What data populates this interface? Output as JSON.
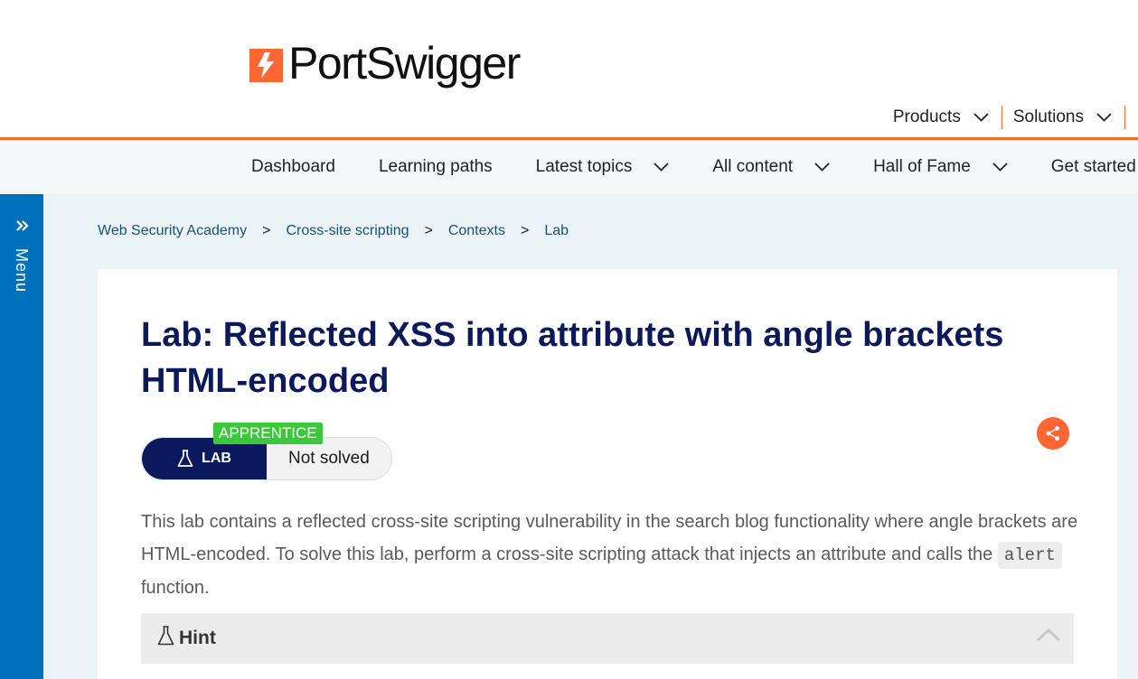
{
  "brand": {
    "name": "PortSwigger"
  },
  "top_nav": {
    "products_label": "Products",
    "solutions_label": "Solutions"
  },
  "academy_nav": {
    "items": [
      {
        "label": "Dashboard"
      },
      {
        "label": "Learning paths"
      },
      {
        "label": "Latest topics"
      },
      {
        "label": "All content"
      },
      {
        "label": "Hall of Fame"
      },
      {
        "label": "Get started"
      }
    ]
  },
  "side_menu": {
    "label": "Menu",
    "icon": "double-chevron-right-icon"
  },
  "breadcrumb": {
    "items": [
      {
        "label": "Web Security Academy"
      },
      {
        "label": "Cross-site scripting"
      },
      {
        "label": "Contexts"
      },
      {
        "label": "Lab"
      }
    ],
    "separator": ">"
  },
  "lab": {
    "title": "Lab: Reflected XSS into attribute with angle brackets HTML-encoded",
    "badge_label": "LAB",
    "level": "APPRENTICE",
    "status": "Not solved",
    "description_before": "This lab contains a reflected cross-site scripting vulnerability in the search blog functionality where angle brackets are HTML-encoded. To solve this lab, perform a cross-site scripting attack that injects an attribute and calls the ",
    "description_code": "alert",
    "description_after": " function.",
    "hint_label": "Hint"
  },
  "colors": {
    "accent_orange": "#ff6633",
    "navy": "#0c1a5c",
    "menu_blue": "#0071bc",
    "level_green": "#3cc73c",
    "page_bg": "#eaf4f6"
  }
}
